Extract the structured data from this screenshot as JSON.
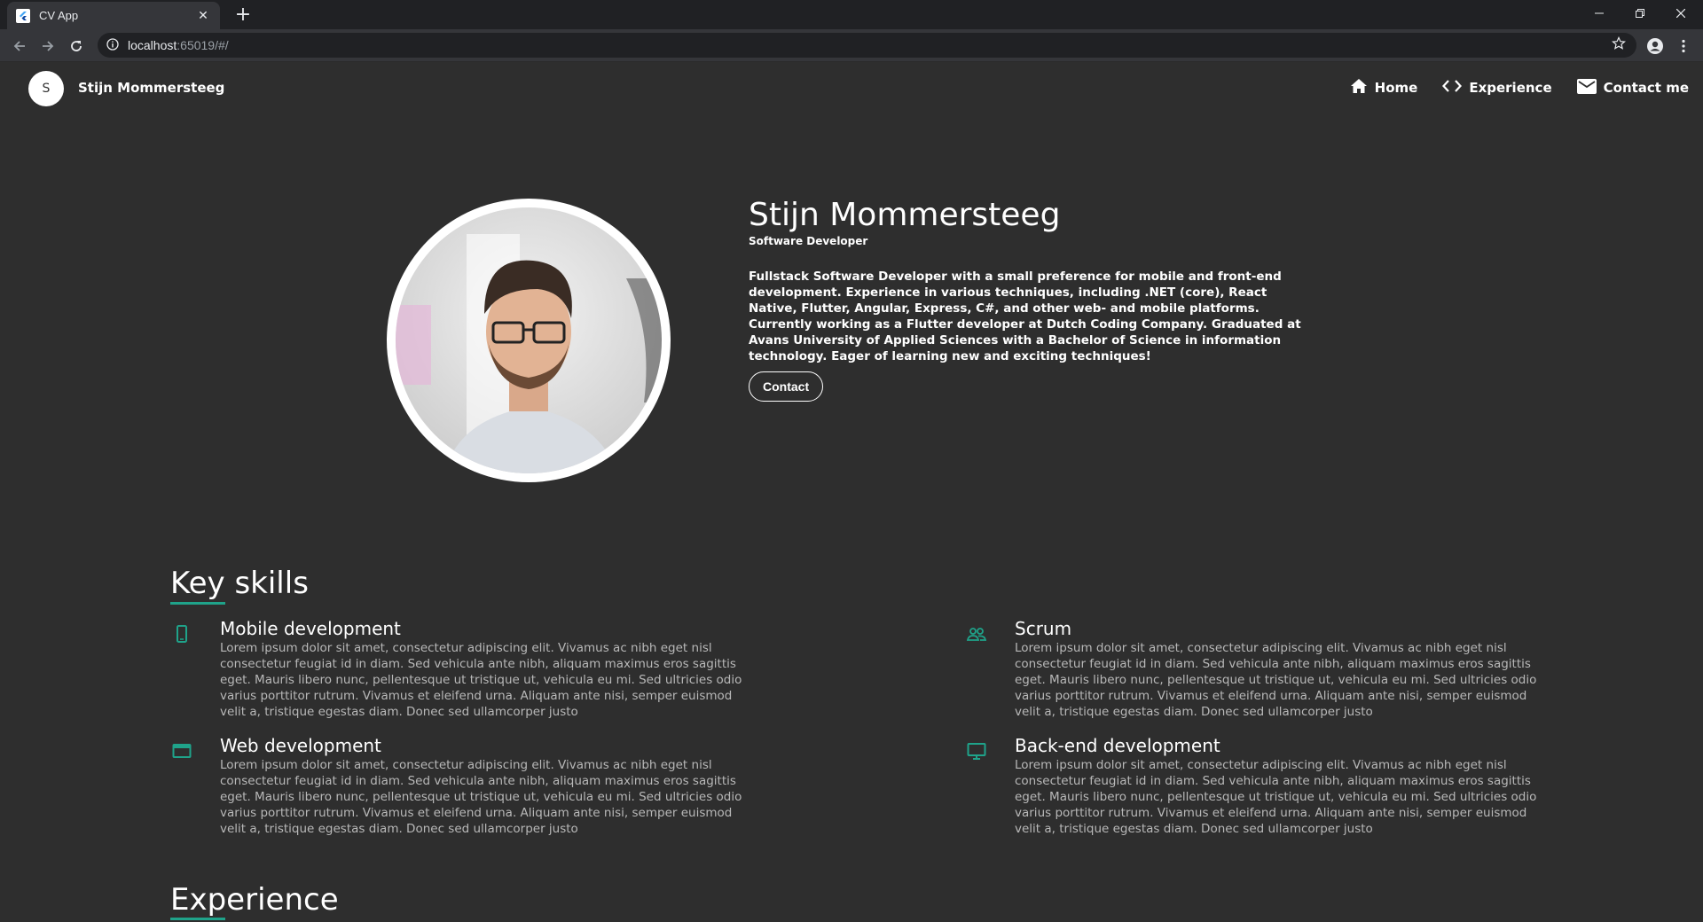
{
  "browser": {
    "tab_title": "CV App",
    "url_host": "localhost",
    "url_rest": ":65019/#/"
  },
  "appbar": {
    "avatar_letter": "S",
    "name": "Stijn Mommersteeg",
    "nav": [
      {
        "label": "Home",
        "icon": "home-icon"
      },
      {
        "label": "Experience",
        "icon": "code-icon"
      },
      {
        "label": "Contact me",
        "icon": "mail-icon"
      }
    ]
  },
  "hero": {
    "name": "Stijn Mommersteeg",
    "role": "Software Developer",
    "bio": "Fullstack Software Developer with a small preference for mobile and front-end development. Experience in various techniques, including .NET (core), React Native, Flutter, Angular, Express, C#, and other web- and mobile platforms. Currently working as a Flutter developer at Dutch Coding Company. Graduated at Avans University of Applied Sciences with a Bachelor of Science in information technology. Eager of learning new and exciting techniques!",
    "contact_label": "Contact"
  },
  "skills": {
    "title": "Key skills",
    "items": [
      {
        "title": "Mobile development",
        "icon": "smartphone-icon",
        "body": "Lorem ipsum dolor sit amet, consectetur adipiscing elit. Vivamus ac nibh eget nisl consectetur feugiat id in diam. Sed vehicula ante nibh, aliquam maximus eros sagittis eget. Mauris libero nunc, pellentesque ut tristique ut, vehicula eu mi. Sed ultricies odio varius porttitor rutrum. Vivamus et eleifend urna. Aliquam ante nisi, semper euismod velit a, tristique egestas diam. Donec sed ullamcorper justo"
      },
      {
        "title": "Scrum",
        "icon": "people-icon",
        "body": "Lorem ipsum dolor sit amet, consectetur adipiscing elit. Vivamus ac nibh eget nisl consectetur feugiat id in diam. Sed vehicula ante nibh, aliquam maximus eros sagittis eget. Mauris libero nunc, pellentesque ut tristique ut, vehicula eu mi. Sed ultricies odio varius porttitor rutrum. Vivamus et eleifend urna. Aliquam ante nisi, semper euismod velit a, tristique egestas diam. Donec sed ullamcorper justo"
      },
      {
        "title": "Web development",
        "icon": "web-icon",
        "body": "Lorem ipsum dolor sit amet, consectetur adipiscing elit. Vivamus ac nibh eget nisl consectetur feugiat id in diam. Sed vehicula ante nibh, aliquam maximus eros sagittis eget. Mauris libero nunc, pellentesque ut tristique ut, vehicula eu mi. Sed ultricies odio varius porttitor rutrum. Vivamus et eleifend urna. Aliquam ante nisi, semper euismod velit a, tristique egestas diam. Donec sed ullamcorper justo"
      },
      {
        "title": "Back-end development",
        "icon": "monitor-icon",
        "body": "Lorem ipsum dolor sit amet, consectetur adipiscing elit. Vivamus ac nibh eget nisl consectetur feugiat id in diam. Sed vehicula ante nibh, aliquam maximus eros sagittis eget. Mauris libero nunc, pellentesque ut tristique ut, vehicula eu mi. Sed ultricies odio varius porttitor rutrum. Vivamus et eleifend urna. Aliquam ante nisi, semper euismod velit a, tristique egestas diam. Donec sed ullamcorper justo"
      }
    ]
  },
  "experience": {
    "title": "Experience"
  },
  "colors": {
    "background": "#2e2e2e",
    "accent": "#1fa38a"
  }
}
